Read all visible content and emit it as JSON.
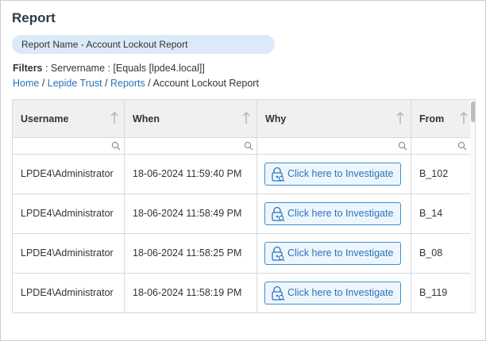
{
  "header": {
    "title": "Report"
  },
  "report_name": "Report Name - Account Lockout Report",
  "filters": {
    "label": "Filters",
    "text": " : Servername : [Equals [lpde4.local]]"
  },
  "breadcrumb": {
    "items": [
      "Home",
      "Lepide Trust",
      "Reports"
    ],
    "sep": " / ",
    "current": "Account Lockout Report"
  },
  "table": {
    "columns": [
      "Username",
      "When",
      "Why",
      "From"
    ],
    "investigate_label": "Click here to Investigate",
    "rows": [
      {
        "username": "LPDE4\\Administrator",
        "when": "18-06-2024 11:59:40 PM",
        "from": "B_102"
      },
      {
        "username": "LPDE4\\Administrator",
        "when": "18-06-2024 11:58:49 PM",
        "from": "B_14"
      },
      {
        "username": "LPDE4\\Administrator",
        "when": "18-06-2024 11:58:25 PM",
        "from": "B_08"
      },
      {
        "username": "LPDE4\\Administrator",
        "when": "18-06-2024 11:58:19 PM",
        "from": "B_119"
      }
    ]
  },
  "colors": {
    "accent": "#2a73b8",
    "pill_bg": "#dce9f8",
    "header_bg": "#f0f0f0"
  },
  "icons": {
    "sort": "arrow-up-icon",
    "filter": "search-icon",
    "investigate": "lock-search-icon"
  }
}
